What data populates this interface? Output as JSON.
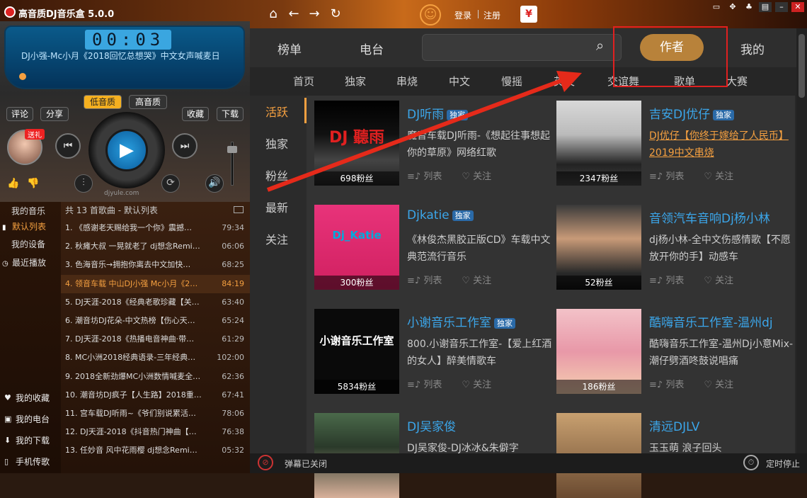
{
  "window": {
    "title": "高音质DJ音乐盒 5.0.0",
    "login": "登录",
    "register": "注册"
  },
  "player": {
    "time": "00:03",
    "now_playing": "DJ小强-Mc小月《2018回忆总想哭》中文女声喊麦日",
    "low_quality": "低音质",
    "high_quality": "高音质",
    "comment": "评论",
    "share": "分享",
    "collect": "收藏",
    "download": "下载",
    "gift": "送礼",
    "site": "djyule.com"
  },
  "left_nav": [
    {
      "label": "我的音乐",
      "active": false
    },
    {
      "label": "默认列表",
      "active": true
    },
    {
      "label": "我的设备",
      "active": false
    },
    {
      "label": "最近播放",
      "active": false
    }
  ],
  "left_bottom": [
    {
      "label": "我的收藏",
      "icon": "heart-icon"
    },
    {
      "label": "我的电台",
      "icon": "radio-icon"
    },
    {
      "label": "我的下载",
      "icon": "download-icon"
    },
    {
      "label": "手机传歌",
      "icon": "phone-icon"
    }
  ],
  "playlist": {
    "header": "共 13 首歌曲 - 默认列表",
    "items": [
      {
        "title": "1. 《感谢老天赐给我一个你》震撼…",
        "dur": "79:34"
      },
      {
        "title": "2. 秋瘫大叔 一晃就老了 dj想念Remi…",
        "dur": "06:06"
      },
      {
        "title": "3. 色海音乐→拥抱你离去中文加快…",
        "dur": "68:25"
      },
      {
        "title": "4. 领音车载 中山DJ小强 Mc小月《2…",
        "dur": "84:19"
      },
      {
        "title": "5. DJ天涯-2018《经典老歌珍藏【关…",
        "dur": "63:40"
      },
      {
        "title": "6. 潮音坊DJ花朵-中文热榜【伤心天…",
        "dur": "65:24"
      },
      {
        "title": "7. DJ天涯-2018《热播电音神曲·带…",
        "dur": "61:29"
      },
      {
        "title": "8. MC小洲2018经典语录-三年经典…",
        "dur": "102:00"
      },
      {
        "title": "9. 2018全新劲爆MC小洲数情喊麦全…",
        "dur": "62:36"
      },
      {
        "title": "10. 潮音坊DJ疯子【人生路】2018重…",
        "dur": "67:41"
      },
      {
        "title": "11. 宫车载DJ听雨~《爷们别说累活…",
        "dur": "78:06"
      },
      {
        "title": "12. DJ天涯-2018《抖音热门神曲【…",
        "dur": "76:38"
      },
      {
        "title": "13. 任妙音 风中花雨樱 dj想念Remi…",
        "dur": "05:32"
      }
    ],
    "active_index": 3
  },
  "tabs": [
    "榜单",
    "电台",
    "作者",
    "我的"
  ],
  "subnav": [
    "首页",
    "独家",
    "串烧",
    "中文",
    "慢摇",
    "英文",
    "交谊舞",
    "歌单",
    "大赛"
  ],
  "side_cats": [
    {
      "label": "活跃",
      "active": true
    },
    {
      "label": "独家",
      "active": false
    },
    {
      "label": "粉丝",
      "active": false
    },
    {
      "label": "最新",
      "active": false
    },
    {
      "label": "关注",
      "active": false
    }
  ],
  "actions": {
    "list": "列表",
    "follow": "关注"
  },
  "exclusive": "独家",
  "cards": [
    {
      "name": "DJ听雨",
      "exclusive": true,
      "fans": "698粉丝",
      "desc": "魔音车载DJ听雨-《想起往事想起你的草原》网络红歌",
      "desc_orange": false,
      "img_text": "DJ 聽雨",
      "img_bg": "linear-gradient(180deg,#000 0%,#111 40%,#444 70%,#222 100%)",
      "img_color": "#e02020"
    },
    {
      "name": "吉安DJ优仔",
      "exclusive": true,
      "fans": "2347粉丝",
      "desc": "DJ优仔【你终于嫁给了人民币】2019中文串烧",
      "desc_orange": true,
      "img_text": "",
      "img_bg": "linear-gradient(180deg,#d8d8d8 0%,#bbb 40%,#222 75%,#444 100%)",
      "img_color": "#000"
    },
    {
      "name": "Djkatie",
      "exclusive": true,
      "fans": "300粉丝",
      "desc": "《林俊杰黑胶正版CD》车载中文典范流行音乐",
      "desc_orange": false,
      "img_text": "Dj_Katie",
      "img_bg": "linear-gradient(180deg,#e8337a,#d02060)",
      "img_color": "#0ad"
    },
    {
      "name": "音领汽车音响Dj杨小林",
      "exclusive": false,
      "fans": "52粉丝",
      "desc": "dj杨小林-全中文伤感情歌【不愿放开你的手】动感车",
      "desc_orange": false,
      "img_text": "",
      "img_bg": "linear-gradient(180deg,#3a3a3a 0%,#c89a78 40%,#2a2a2a 80%,#111 100%)",
      "img_color": "#fff"
    },
    {
      "name": "小谢音乐工作室",
      "exclusive": true,
      "fans": "5834粉丝",
      "desc": "800.小谢音乐工作室-【爱上红酒的女人】醉美情歌车",
      "desc_orange": false,
      "img_text": "小谢音乐工作室",
      "img_bg": "#0a0a0a",
      "img_color": "#fff"
    },
    {
      "name": "酷嗨音乐工作室-温州dj",
      "exclusive": false,
      "fans": "186粉丝",
      "desc": "酷嗨音乐工作室-温州Dj小意Mix-潮仔劈酒咚鼓说唱痛",
      "desc_orange": false,
      "img_text": "",
      "img_bg": "linear-gradient(180deg,#f3c2c8,#e898a8 50%,#f5d0b0)",
      "img_color": "#000"
    },
    {
      "name": "DJ吴家俊",
      "exclusive": false,
      "fans": "",
      "desc": "DJ吴家俊-DJ冰冰&朱僻字",
      "desc_orange": false,
      "img_text": "",
      "img_bg": "linear-gradient(180deg,#4a6a4a,#2a3a2a 40%,#d8b09a)",
      "img_color": "#fff"
    },
    {
      "name": "清远DJLV",
      "exclusive": false,
      "fans": "",
      "desc": "玉玉萌 浪子回头",
      "desc_orange": false,
      "img_text": "",
      "img_bg": "linear-gradient(180deg,#c8a070,#6a4a30)",
      "img_color": "#fff"
    }
  ],
  "bottom": {
    "danmu": "弹幕已关闭",
    "timer_stop": "定时停止"
  }
}
